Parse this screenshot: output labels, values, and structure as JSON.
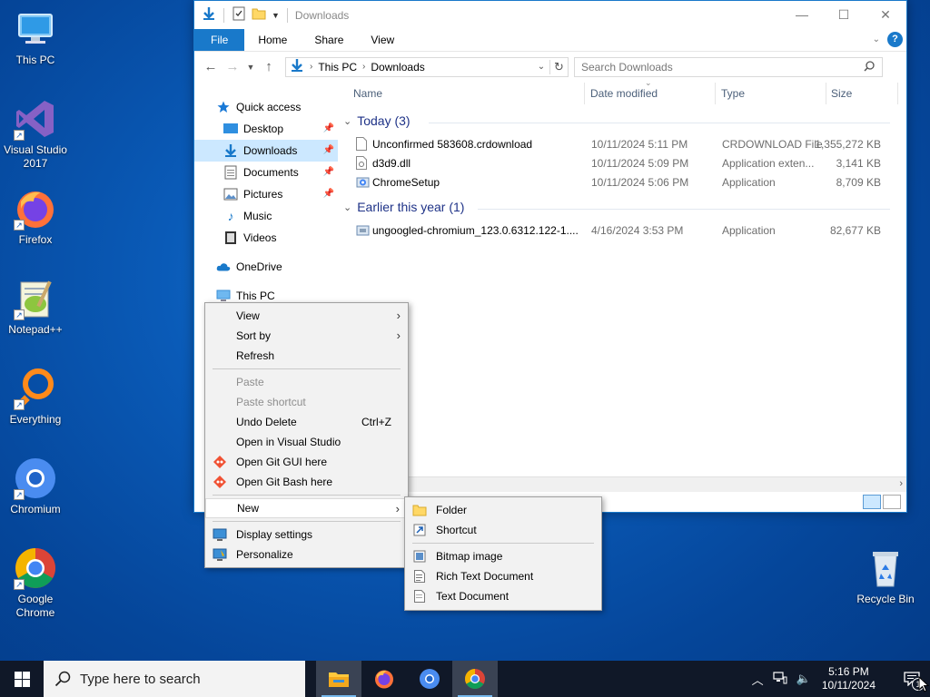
{
  "desktop": {
    "icons": [
      {
        "label": "This PC"
      },
      {
        "label": "Visual Studio 2017"
      },
      {
        "label": "Firefox"
      },
      {
        "label": "Notepad++"
      },
      {
        "label": "Everything"
      },
      {
        "label": "Chromium"
      },
      {
        "label": "Google Chrome"
      },
      {
        "label": "Recycle Bin"
      }
    ]
  },
  "explorer": {
    "title": "Downloads",
    "ribbon_tabs": [
      "File",
      "Home",
      "Share",
      "View"
    ],
    "address": {
      "crumbs": [
        "This PC",
        "Downloads"
      ]
    },
    "search": {
      "placeholder": "Search Downloads"
    },
    "nav": {
      "quick_access": "Quick access",
      "items": [
        "Desktop",
        "Downloads",
        "Documents",
        "Pictures",
        "Music",
        "Videos"
      ],
      "onedrive": "OneDrive",
      "this_pc": "This PC"
    },
    "columns": {
      "name": "Name",
      "date": "Date modified",
      "type": "Type",
      "size": "Size"
    },
    "groups": [
      {
        "header": "Today (3)",
        "files": [
          {
            "name": "Unconfirmed 583608.crdownload",
            "date": "10/11/2024 5:11 PM",
            "type": "CRDOWNLOAD File",
            "size": "1,355,272 KB"
          },
          {
            "name": "d3d9.dll",
            "date": "10/11/2024 5:09 PM",
            "type": "Application exten...",
            "size": "3,141 KB"
          },
          {
            "name": "ChromeSetup",
            "date": "10/11/2024 5:06 PM",
            "type": "Application",
            "size": "8,709 KB"
          }
        ]
      },
      {
        "header": "Earlier this year (1)",
        "files": [
          {
            "name": "ungoogled-chromium_123.0.6312.122-1....",
            "date": "4/16/2024 3:53 PM",
            "type": "Application",
            "size": "82,677 KB"
          }
        ]
      }
    ]
  },
  "context_menu": {
    "view": "View",
    "sort_by": "Sort by",
    "refresh": "Refresh",
    "paste": "Paste",
    "paste_shortcut": "Paste shortcut",
    "undo_delete": "Undo Delete",
    "undo_shortcut": "Ctrl+Z",
    "open_vs": "Open in Visual Studio",
    "git_gui": "Open Git GUI here",
    "git_bash": "Open Git Bash here",
    "new": "New",
    "display_settings": "Display settings",
    "personalize": "Personalize"
  },
  "new_submenu": {
    "folder": "Folder",
    "shortcut": "Shortcut",
    "bitmap": "Bitmap image",
    "rtf": "Rich Text Document",
    "text": "Text Document"
  },
  "taskbar": {
    "search_placeholder": "Type here to search",
    "time": "5:16 PM",
    "date": "10/11/2024",
    "notification_count": "1"
  },
  "colors": {
    "accent": "#1979ca",
    "selection": "#cce8ff",
    "taskbar": "#101828"
  }
}
